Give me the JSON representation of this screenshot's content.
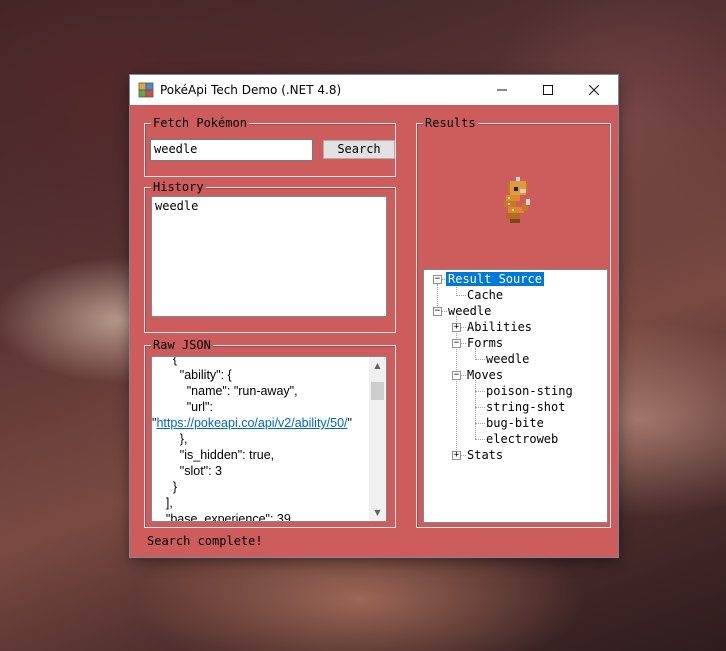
{
  "window": {
    "title": "PokéApi Tech Demo (.NET 4.8)",
    "controls": {
      "minimize": "—",
      "maximize": "☐",
      "close": "✕"
    }
  },
  "fetch": {
    "legend": "Fetch Pokémon",
    "input_value": "weedle",
    "search_label": "Search"
  },
  "history": {
    "legend": "History",
    "items": [
      "weedle"
    ]
  },
  "raw_json": {
    "legend": "Raw JSON",
    "lines": [
      "      {",
      "        \"ability\": {",
      "          \"name\": \"run-away\",",
      "          \"url\":",
      "\"https://pokeapi.co/api/v2/ability/50/\"",
      "        },",
      "        \"is_hidden\": true,",
      "        \"slot\": 3",
      "      }",
      "    ],",
      "    \"base_experience\": 39,"
    ],
    "url_text": "https://pokeapi.co/api/v2/ability/50/"
  },
  "results": {
    "legend": "Results",
    "sprite": "weedle-sprite",
    "tree": {
      "result_source": "Result Source",
      "cache": "Cache",
      "root": "weedle",
      "abilities": "Abilities",
      "forms": "Forms",
      "form_item": "weedle",
      "moves": "Moves",
      "move_items": [
        "poison-sting",
        "string-shot",
        "bug-bite",
        "electroweb"
      ],
      "stats": "Stats"
    }
  },
  "status": "Search complete!",
  "colors": {
    "window_bg": "#cd5c5c",
    "selection": "#0078d7",
    "link": "#0066cc"
  }
}
